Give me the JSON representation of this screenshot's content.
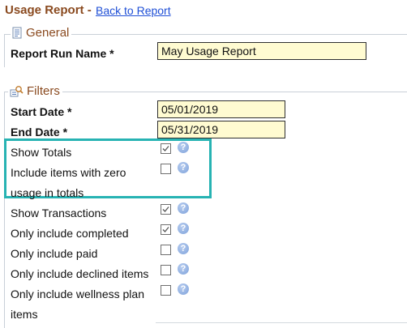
{
  "header": {
    "title": "Usage Report -",
    "back_link": "Back to Report"
  },
  "general": {
    "legend": "General",
    "report_run_name_label": "Report Run Name *",
    "report_run_name_value": "May Usage Report"
  },
  "filters": {
    "legend": "Filters",
    "start_date_label": "Start Date *",
    "start_date_value": "05/01/2019",
    "end_date_label": "End Date *",
    "end_date_value": "05/31/2019",
    "options": [
      {
        "label": "Show Totals",
        "checked": true
      },
      {
        "label_line1": "Include items with zero",
        "label_line2": "usage in totals",
        "checked": false
      },
      {
        "label": "Show Transactions",
        "checked": true
      },
      {
        "label": "Only include completed",
        "checked": true
      },
      {
        "label": "Only include paid",
        "checked": false
      },
      {
        "label": "Only include declined items",
        "checked": false
      },
      {
        "label_line1": "Only include wellness plan",
        "label_line2": "items",
        "checked": false
      }
    ],
    "help_glyph": "?"
  },
  "icons": {
    "general": "document-icon",
    "filters": "filter-icon",
    "help": "help-icon"
  },
  "colors": {
    "title": "#8a4a1f",
    "link": "#1f4fd6",
    "input_bg": "#fffbd1",
    "highlight": "#27b3b3"
  }
}
